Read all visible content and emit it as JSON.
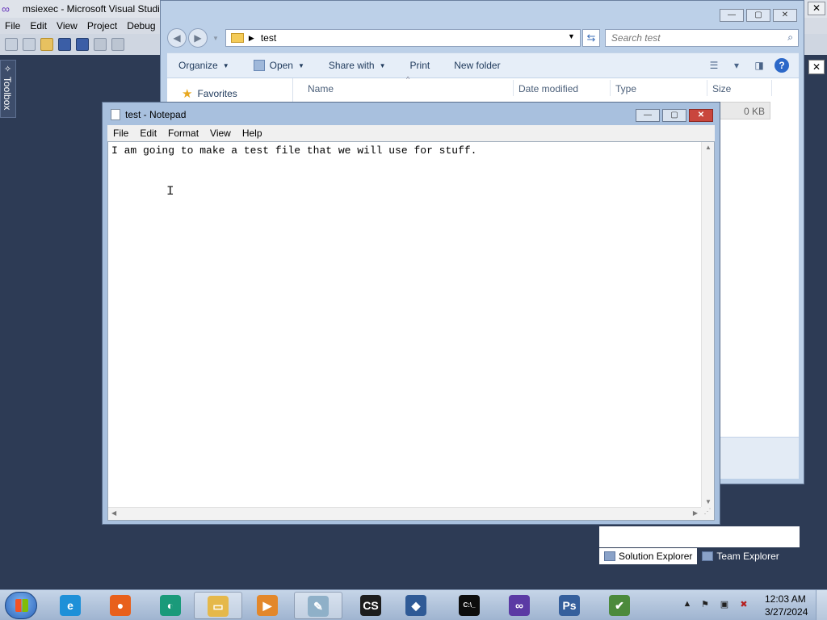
{
  "visual_studio": {
    "title": "msiexec - Microsoft Visual Studio",
    "menu": [
      "File",
      "Edit",
      "View",
      "Project",
      "Debug"
    ],
    "toolbox_label": "Toolbox",
    "close_glyph": "✕",
    "bottom_tabs": [
      {
        "label": "Solution Explorer",
        "active": true
      },
      {
        "label": "Team Explorer",
        "active": false
      }
    ]
  },
  "explorer": {
    "controls": {
      "minimize": "—",
      "maximize": "▢",
      "close": "✕"
    },
    "address_path": "test",
    "search_placeholder": "Search test",
    "commands": [
      {
        "label": "Organize",
        "dropdown": true
      },
      {
        "label": "Open",
        "dropdown": true
      },
      {
        "label": "Share with",
        "dropdown": true
      },
      {
        "label": "Print",
        "dropdown": false
      },
      {
        "label": "New folder",
        "dropdown": false
      }
    ],
    "help_glyph": "?",
    "nav_pane": {
      "favorites": "Favorites"
    },
    "columns": [
      "Name",
      "Date modified",
      "Type",
      "Size"
    ],
    "file_size": "0 KB"
  },
  "notepad": {
    "title": "test - Notepad",
    "menu": [
      "File",
      "Edit",
      "Format",
      "View",
      "Help"
    ],
    "content": "I am going to make a test file that we will use for stuff."
  },
  "taskbar": {
    "apps": [
      {
        "name": "internet-explorer",
        "glyph": "e",
        "color": "#1e90d8",
        "active": false
      },
      {
        "name": "firefox",
        "glyph": "●",
        "color": "#e8601c",
        "active": false
      },
      {
        "name": "app-globe",
        "glyph": "◐",
        "color": "#1a9a7a",
        "active": false
      },
      {
        "name": "file-explorer",
        "glyph": "▭",
        "color": "#e5b84a",
        "active": true
      },
      {
        "name": "media-player",
        "glyph": "▶",
        "color": "#e3872a",
        "active": false
      },
      {
        "name": "notepad",
        "glyph": "✎",
        "color": "#8fb0c8",
        "active": true
      },
      {
        "name": "cs-app",
        "glyph": "CS",
        "color": "#1d1d1d",
        "active": false
      },
      {
        "name": "virtualbox",
        "glyph": "◆",
        "color": "#2f5a96",
        "active": false
      },
      {
        "name": "command-prompt",
        "glyph": "C:\\_",
        "color": "#0d0d0d",
        "active": false
      },
      {
        "name": "visual-studio",
        "glyph": "∞",
        "color": "#5b3aa4",
        "active": false
      },
      {
        "name": "powershell",
        "glyph": "Ps",
        "color": "#355f9c",
        "active": false
      },
      {
        "name": "action-center",
        "glyph": "✔",
        "color": "#4c8a3c",
        "active": false
      }
    ],
    "clock": {
      "time": "12:03 AM",
      "date": "3/27/2024"
    }
  }
}
